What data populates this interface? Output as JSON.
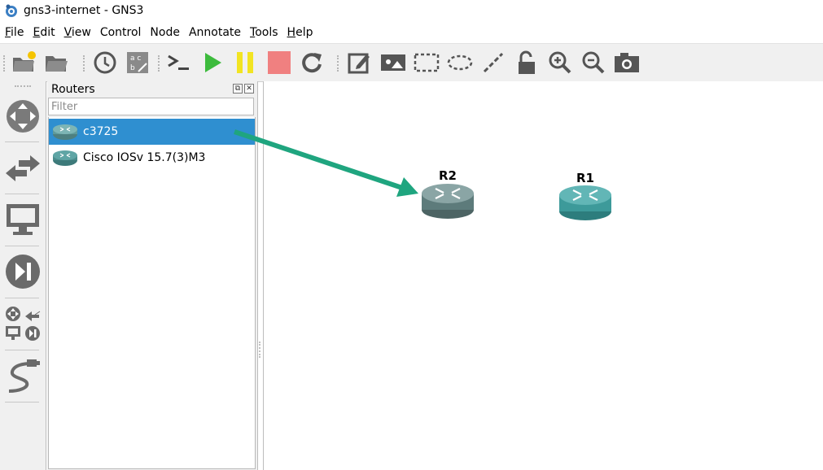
{
  "window": {
    "title": "gns3-internet - GNS3"
  },
  "menubar": [
    {
      "label": "File",
      "mnemonic": "F",
      "rest": "ile"
    },
    {
      "label": "Edit",
      "mnemonic": "E",
      "rest": "dit"
    },
    {
      "label": "View",
      "mnemonic": "V",
      "rest": "iew"
    },
    {
      "label": "Control",
      "mnemonic": "",
      "rest": "Control"
    },
    {
      "label": "Node",
      "mnemonic": "",
      "rest": "Node"
    },
    {
      "label": "Annotate",
      "mnemonic": "",
      "rest": "Annotate"
    },
    {
      "label": "Tools",
      "mnemonic": "T",
      "rest": "ools"
    },
    {
      "label": "Help",
      "mnemonic": "H",
      "rest": "elp"
    }
  ],
  "toolbar": {
    "icons": [
      "new-project-icon",
      "open-project-icon",
      "snapshot-clock-icon",
      "show-interface-labels-icon",
      "console-all-icon",
      "start-all-icon",
      "suspend-all-icon",
      "stop-all-icon",
      "reload-all-icon",
      "add-note-icon",
      "insert-image-icon",
      "draw-rectangle-icon",
      "draw-ellipse-icon",
      "draw-line-icon",
      "lock-unlock-icon",
      "zoom-in-icon",
      "zoom-out-icon",
      "screenshot-icon"
    ]
  },
  "sidebar": {
    "icons": [
      "browse-routers-icon",
      "browse-switches-icon",
      "browse-end-devices-icon",
      "browse-security-devices-icon",
      "browse-all-devices-icon",
      "add-link-icon"
    ]
  },
  "dock": {
    "title": "Routers",
    "float_btn": "⧉",
    "close_btn": "✕",
    "filter_placeholder": "Filter",
    "filter_value": "",
    "items": [
      {
        "label": "c3725",
        "selected": true
      },
      {
        "label": "Cisco IOSv 15.7(3)M3",
        "selected": false
      }
    ]
  },
  "canvas": {
    "nodes": [
      {
        "label": "R2",
        "color": "#5d7b7b"
      },
      {
        "label": "R1",
        "color": "#3d9a9a"
      }
    ],
    "arrow_color": "#1fa57f"
  },
  "colors": {
    "selection": "#2f8fd0",
    "play": "#3dbb3d",
    "pause": "#f2e422",
    "stop": "#f08080"
  }
}
